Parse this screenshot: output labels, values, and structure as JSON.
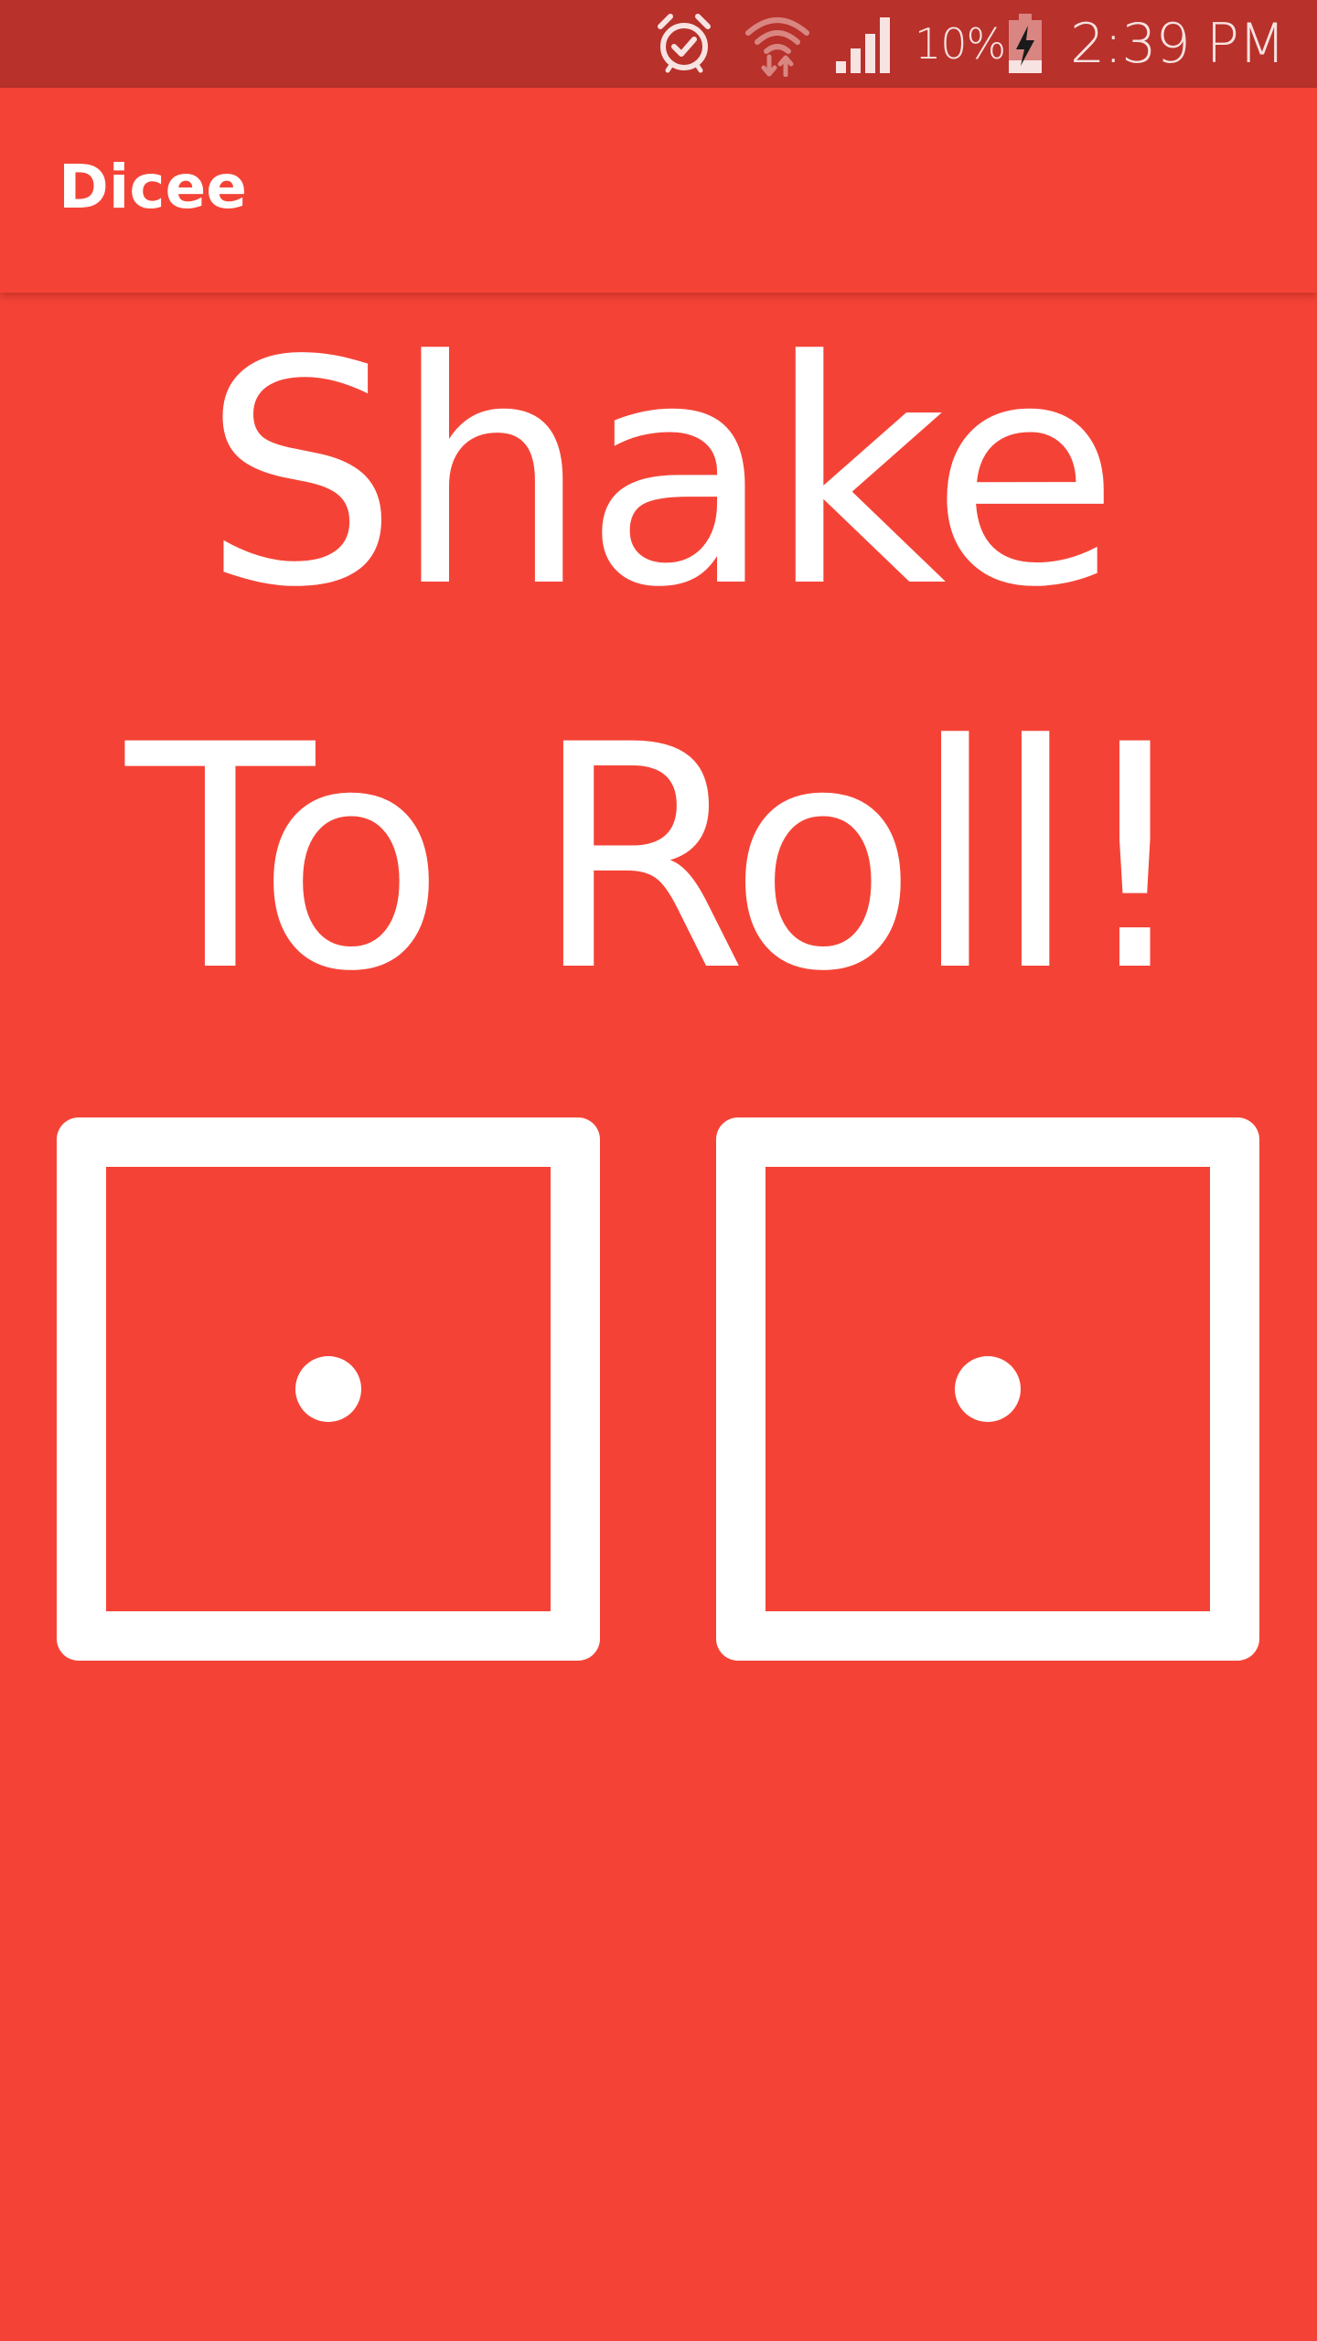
{
  "status_bar": {
    "battery_percent": "10%",
    "time": "2:39 PM",
    "icons": [
      "alarm-icon",
      "wifi-icon",
      "signal-icon",
      "battery-charging-icon"
    ],
    "background_color": "#B8312B"
  },
  "app_bar": {
    "title": "Dicee",
    "background_color": "#F44336"
  },
  "main": {
    "headline_line1": "Shake",
    "headline_line2": "To Roll!",
    "text_color": "#FFFFFF",
    "dice": [
      {
        "position": "left",
        "value": 1
      },
      {
        "position": "right",
        "value": 1
      }
    ]
  }
}
